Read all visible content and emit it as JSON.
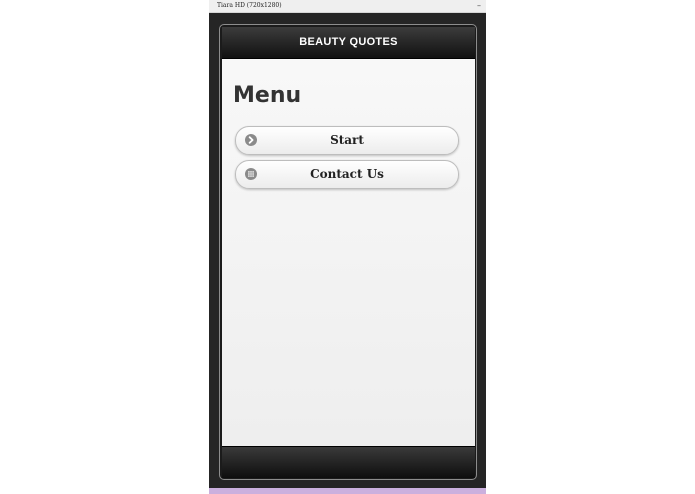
{
  "window": {
    "title": "Tiara HD (720x1280)",
    "minimize_glyph": "–"
  },
  "app": {
    "header_title": "BEAUTY QUOTES"
  },
  "page": {
    "heading": "Menu"
  },
  "menu": {
    "items": [
      {
        "label": "Start",
        "icon": "arrow-right-circle-icon"
      },
      {
        "label": "Contact Us",
        "icon": "grid-icon"
      }
    ]
  },
  "colors": {
    "header_bg": "#1a1a1a",
    "screen_bg": "#f2f2f2",
    "accent_strip": "#cbb0de"
  }
}
